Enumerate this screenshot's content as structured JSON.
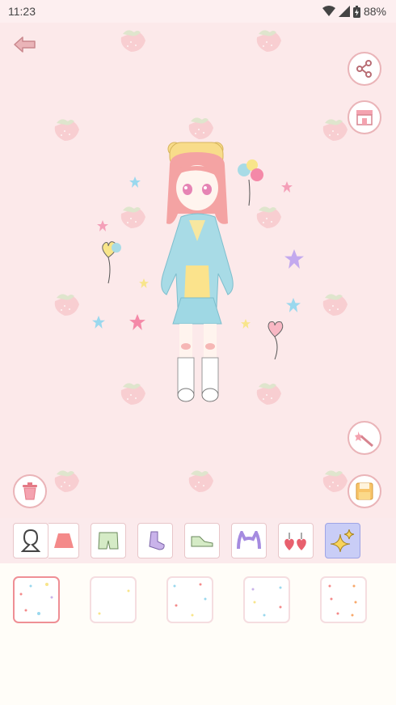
{
  "status_bar": {
    "time": "11:23",
    "battery": "88%"
  },
  "toolbar": {
    "back": "back-arrow-icon",
    "share": "share-icon",
    "shop": "shop-icon",
    "magic": "magic-wand-icon",
    "trash": "trash-icon",
    "save": "save-icon"
  },
  "categories": [
    {
      "id": "body",
      "icon": "body-silhouette-icon",
      "selected": false
    },
    {
      "id": "skirt",
      "icon": "skirt-icon",
      "selected": false
    },
    {
      "id": "shorts",
      "icon": "shorts-icon",
      "selected": false
    },
    {
      "id": "socks",
      "icon": "sock-icon",
      "selected": false
    },
    {
      "id": "shoes",
      "icon": "sneaker-icon",
      "selected": false
    },
    {
      "id": "headwear",
      "icon": "cat-ears-icon",
      "selected": false
    },
    {
      "id": "earrings",
      "icon": "heart-earrings-icon",
      "selected": false
    },
    {
      "id": "effects",
      "icon": "sparkles-icon",
      "selected": true
    }
  ],
  "effect_items": [
    {
      "id": "effect-1",
      "selected": true
    },
    {
      "id": "effect-2",
      "selected": false
    },
    {
      "id": "effect-3",
      "selected": false
    },
    {
      "id": "effect-4",
      "selected": false
    },
    {
      "id": "effect-5",
      "selected": false
    }
  ],
  "colors": {
    "background": "#fce9ea",
    "accent": "#eab4b8",
    "selected_tab": "#c9cdf6"
  }
}
